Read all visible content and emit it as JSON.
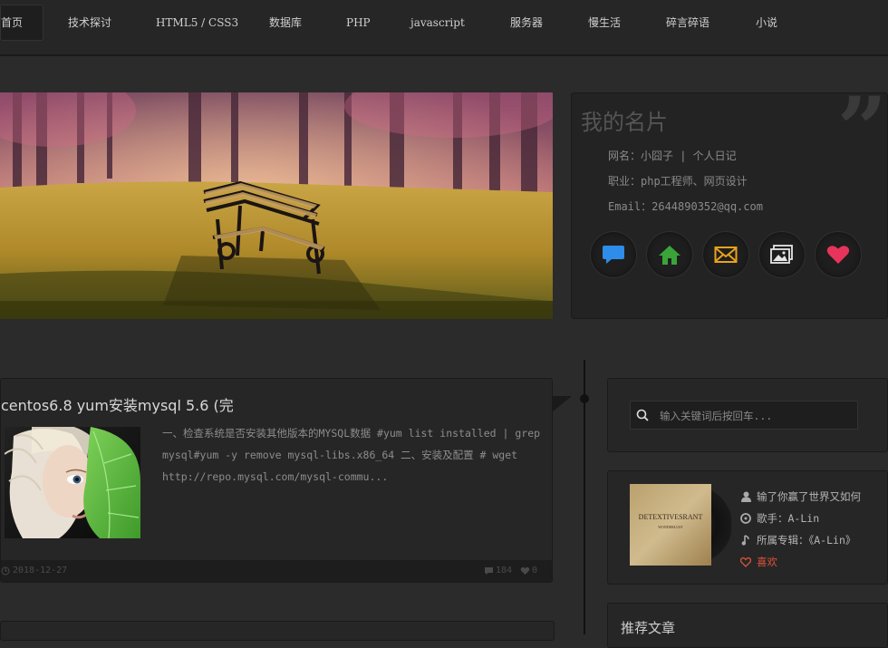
{
  "nav": {
    "items": [
      {
        "label": "首页",
        "active": true
      },
      {
        "label": "技术探讨"
      },
      {
        "label": "HTML5 / CSS3"
      },
      {
        "label": "数据库"
      },
      {
        "label": "PHP"
      },
      {
        "label": "javascript"
      },
      {
        "label": "服务器"
      },
      {
        "label": "慢生活"
      },
      {
        "label": "碎言碎语"
      },
      {
        "label": "小说"
      }
    ]
  },
  "profile": {
    "title": "我的名片",
    "quote_glyph": "”",
    "netname": "网名：小囧子 | 个人日记",
    "job": "职业：php工程师、网页设计",
    "email": "Email：2644890352@qq.com",
    "icons": [
      "chat-icon",
      "home-icon",
      "mail-icon",
      "gallery-icon",
      "heart-icon"
    ],
    "colors": {
      "chat": "#2d8de8",
      "home": "#3aa43a",
      "mail": "#e8a21c",
      "gallery": "#e5e5e5",
      "heart": "#e8345a"
    }
  },
  "post": {
    "title": "centos6.8 yum安装mysql 5.6 (完",
    "excerpt": "一、检查系统是否安装其他版本的MYSQL数据 #yum list installed | grep mysql#yum -y remove mysql-libs.x86_64 二、安装及配置 # wget http://repo.mysql.com/mysql-commu...",
    "date": "2018-12-27",
    "comments": "184",
    "likes": "0"
  },
  "search": {
    "placeholder": "输入关键词后按回车..."
  },
  "music": {
    "song": "输了你赢了世界又如何",
    "singer": "歌手：A-Lin",
    "album": "所属专辑：《A-Lin》",
    "like_label": "喜欢",
    "cover_text": "DETEXTIVESRANT",
    "cover_subtext": "WONDERLUST"
  },
  "recommend": {
    "title": "推荐文章"
  }
}
